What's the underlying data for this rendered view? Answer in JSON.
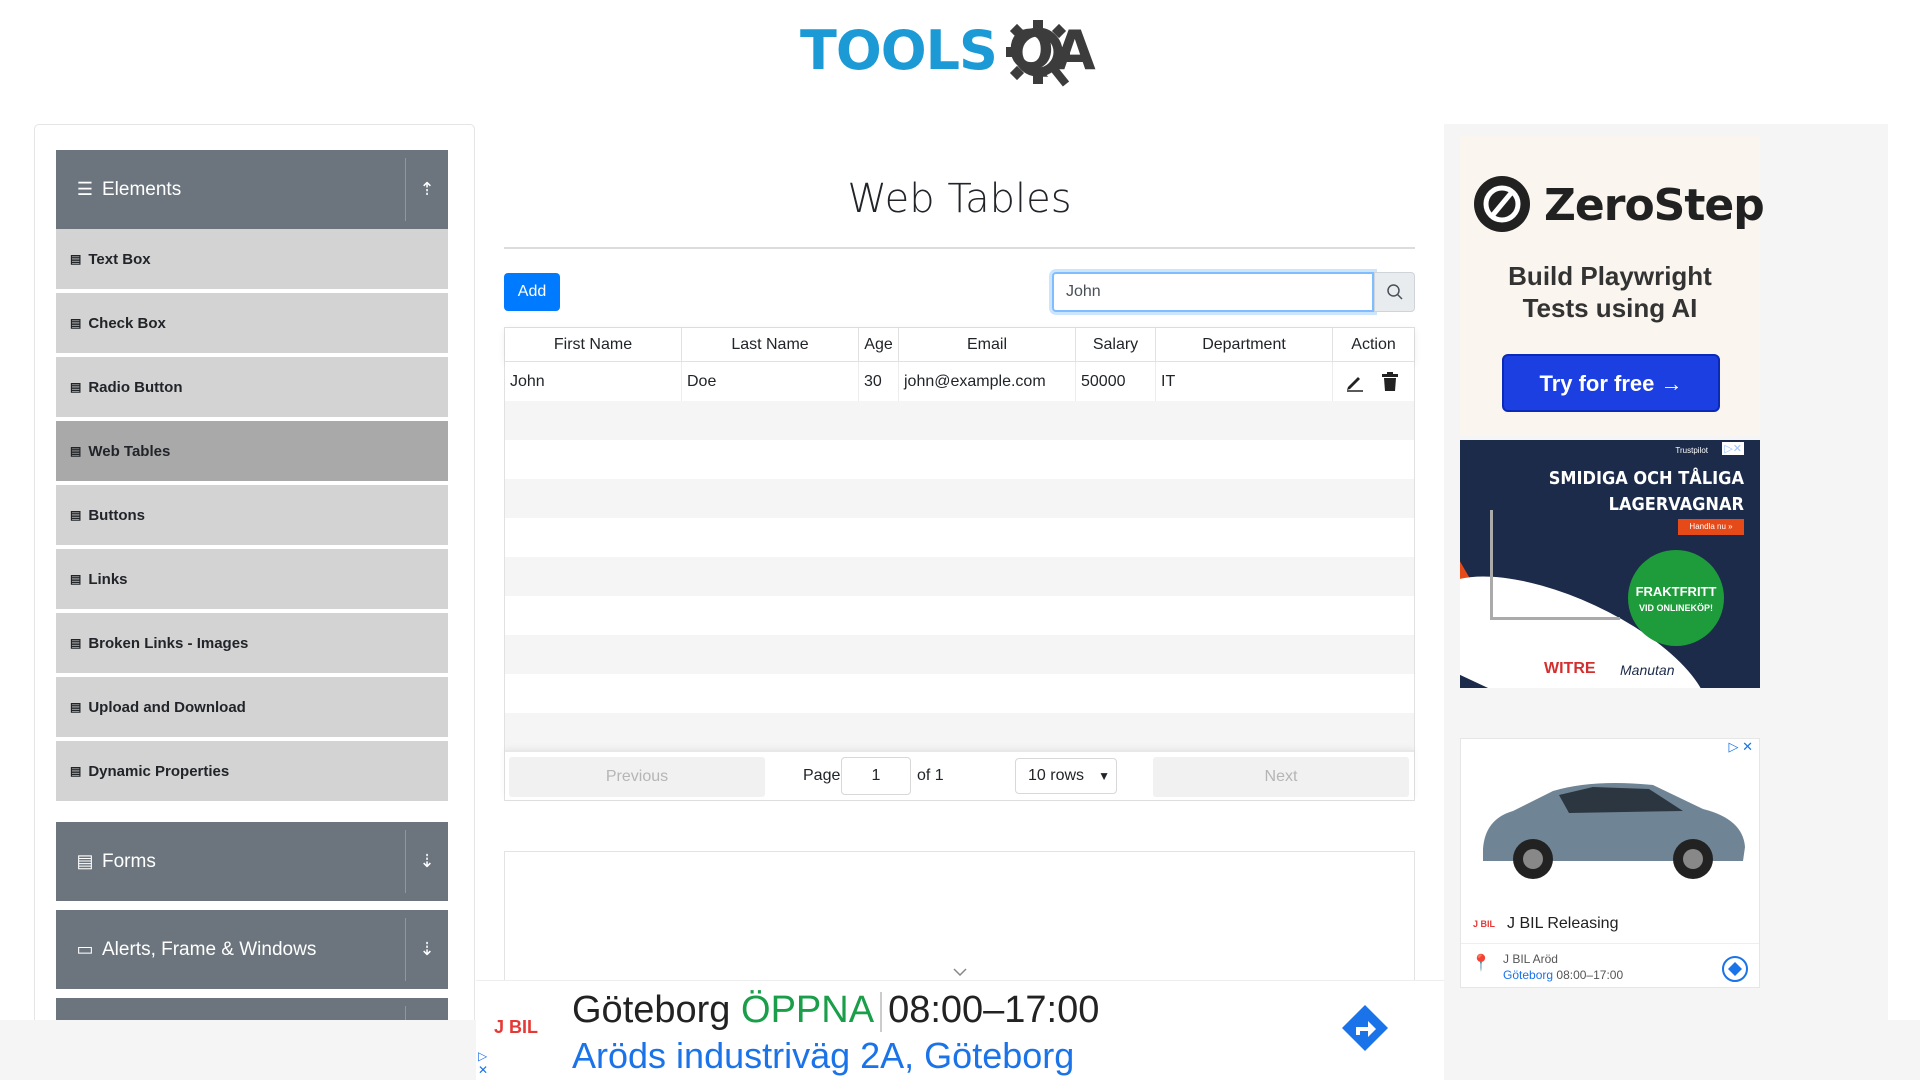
{
  "header": {
    "logo_text_1": "TOOLS",
    "logo_text_2": "QA"
  },
  "sidebar": {
    "groups": [
      {
        "label": "Elements",
        "icon": "hamburger-icon",
        "arrow": "collapse-arrow-icon"
      },
      {
        "label": "Forms",
        "icon": "document-icon",
        "arrow": "expand-arrow-icon"
      },
      {
        "label": "Alerts, Frame & Windows",
        "icon": "window-icon",
        "arrow": "expand-arrow-icon"
      }
    ],
    "items": [
      {
        "label": "Text Box"
      },
      {
        "label": "Check Box"
      },
      {
        "label": "Radio Button"
      },
      {
        "label": "Web Tables",
        "active": true
      },
      {
        "label": "Buttons"
      },
      {
        "label": "Links"
      },
      {
        "label": "Broken Links - Images"
      },
      {
        "label": "Upload and Download"
      },
      {
        "label": "Dynamic Properties"
      }
    ]
  },
  "main": {
    "title": "Web Tables",
    "add_label": "Add",
    "search_value": "John",
    "table": {
      "headers": [
        "First Name",
        "Last Name",
        "Age",
        "Email",
        "Salary",
        "Department",
        "Action"
      ],
      "rows": [
        {
          "first": "John",
          "last": "Doe",
          "age": "30",
          "email": "john@example.com",
          "salary": "50000",
          "department": "IT"
        }
      ]
    },
    "pagination": {
      "previous": "Previous",
      "page_label": "Page",
      "page_value": "1",
      "of_label": "of 1",
      "rows_label": "10 rows",
      "next": "Next"
    }
  },
  "ads": {
    "zerostep": {
      "name": "ZeroStep",
      "tagline_1": "Build Playwright",
      "tagline_2": "Tests using AI",
      "cta": "Try for free →"
    },
    "witre": {
      "line1": "SMIDIGA OCH TÅLIGA",
      "line2": "LAGERVAGNAR",
      "cta": "Handla nu »",
      "badge_1": "FRAKTFRITT",
      "badge_2": "VID ONLINEKÖP!",
      "brand_1": "WITRE",
      "brand_2": "Manutan",
      "trust": "Trustpilot"
    },
    "jbil_card": {
      "title": "J BIL Releasing",
      "brand": "J BIL",
      "place": "J BIL Aröd",
      "city": "Göteborg",
      "hours": "08:00–17:00"
    },
    "bottom": {
      "brand": "J BIL",
      "city": "Göteborg",
      "status": "ÖPPNA",
      "hours": "08:00–17:00",
      "address": "Aröds industriväg 2A, Göteborg"
    }
  },
  "colors": {
    "primary": "#007bff",
    "sidebar_header": "#6c757d",
    "menu_item": "#d3d3d3",
    "menu_active": "#a9a9a9",
    "logo_blue": "#1b9ad6"
  }
}
